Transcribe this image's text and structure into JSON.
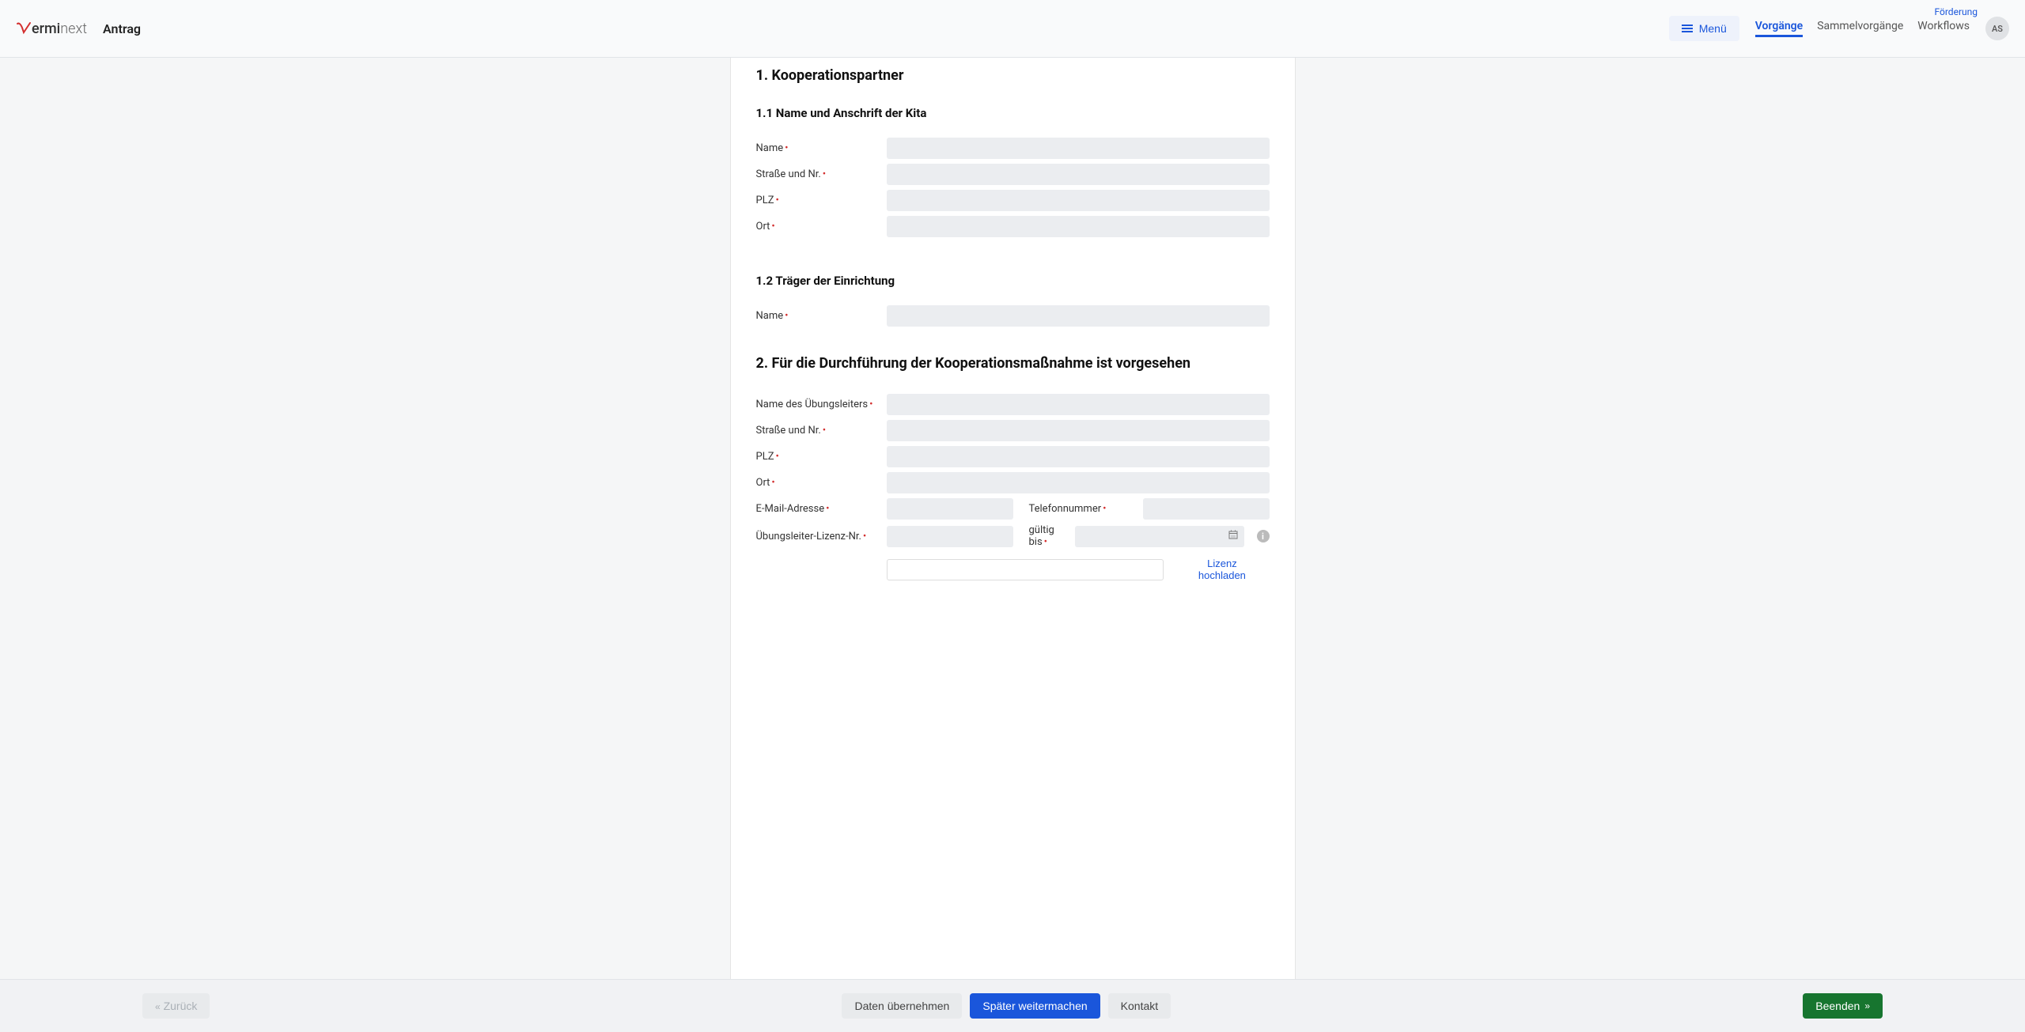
{
  "header": {
    "logo_brand_part1": "ermi",
    "logo_brand_part2": "next",
    "page_title": "Antrag",
    "foerderung_link": "Förderung",
    "menu_label": "Menü",
    "nav": {
      "vorgaenge": "Vorgänge",
      "sammelvorgaenge": "Sammelvorgänge",
      "workflows": "Workflows"
    },
    "avatar_initials": "AS"
  },
  "form": {
    "section1": {
      "title": "1. Kooperationspartner",
      "sub1": {
        "title": "1.1 Name und Anschrift der Kita",
        "name_label": "Name",
        "strasse_label": "Straße und Nr.",
        "plz_label": "PLZ",
        "ort_label": "Ort"
      },
      "sub2": {
        "title": "1.2 Träger der Einrichtung",
        "name_label": "Name"
      }
    },
    "section2": {
      "title": "2. Für die Durchführung der Kooperationsmaßnahme ist vorgesehen",
      "uebungsleiter_label": "Name des Übungsleiters",
      "strasse_label": "Straße und Nr.",
      "plz_label": "PLZ",
      "ort_label": "Ort",
      "email_label": "E-Mail-Adresse",
      "telefon_label": "Telefonnummer",
      "lizenz_nr_label": "Übungsleiter-Lizenz-Nr.",
      "gueltig_bis_label": "gültig bis",
      "lizenz_upload_label": "Lizenz hochladen"
    }
  },
  "footer": {
    "zurueck_label": "Zurück",
    "daten_uebernehmen_label": "Daten übernehmen",
    "spaeter_weitermachen_label": "Später weitermachen",
    "kontakt_label": "Kontakt",
    "beenden_label": "Beenden"
  }
}
